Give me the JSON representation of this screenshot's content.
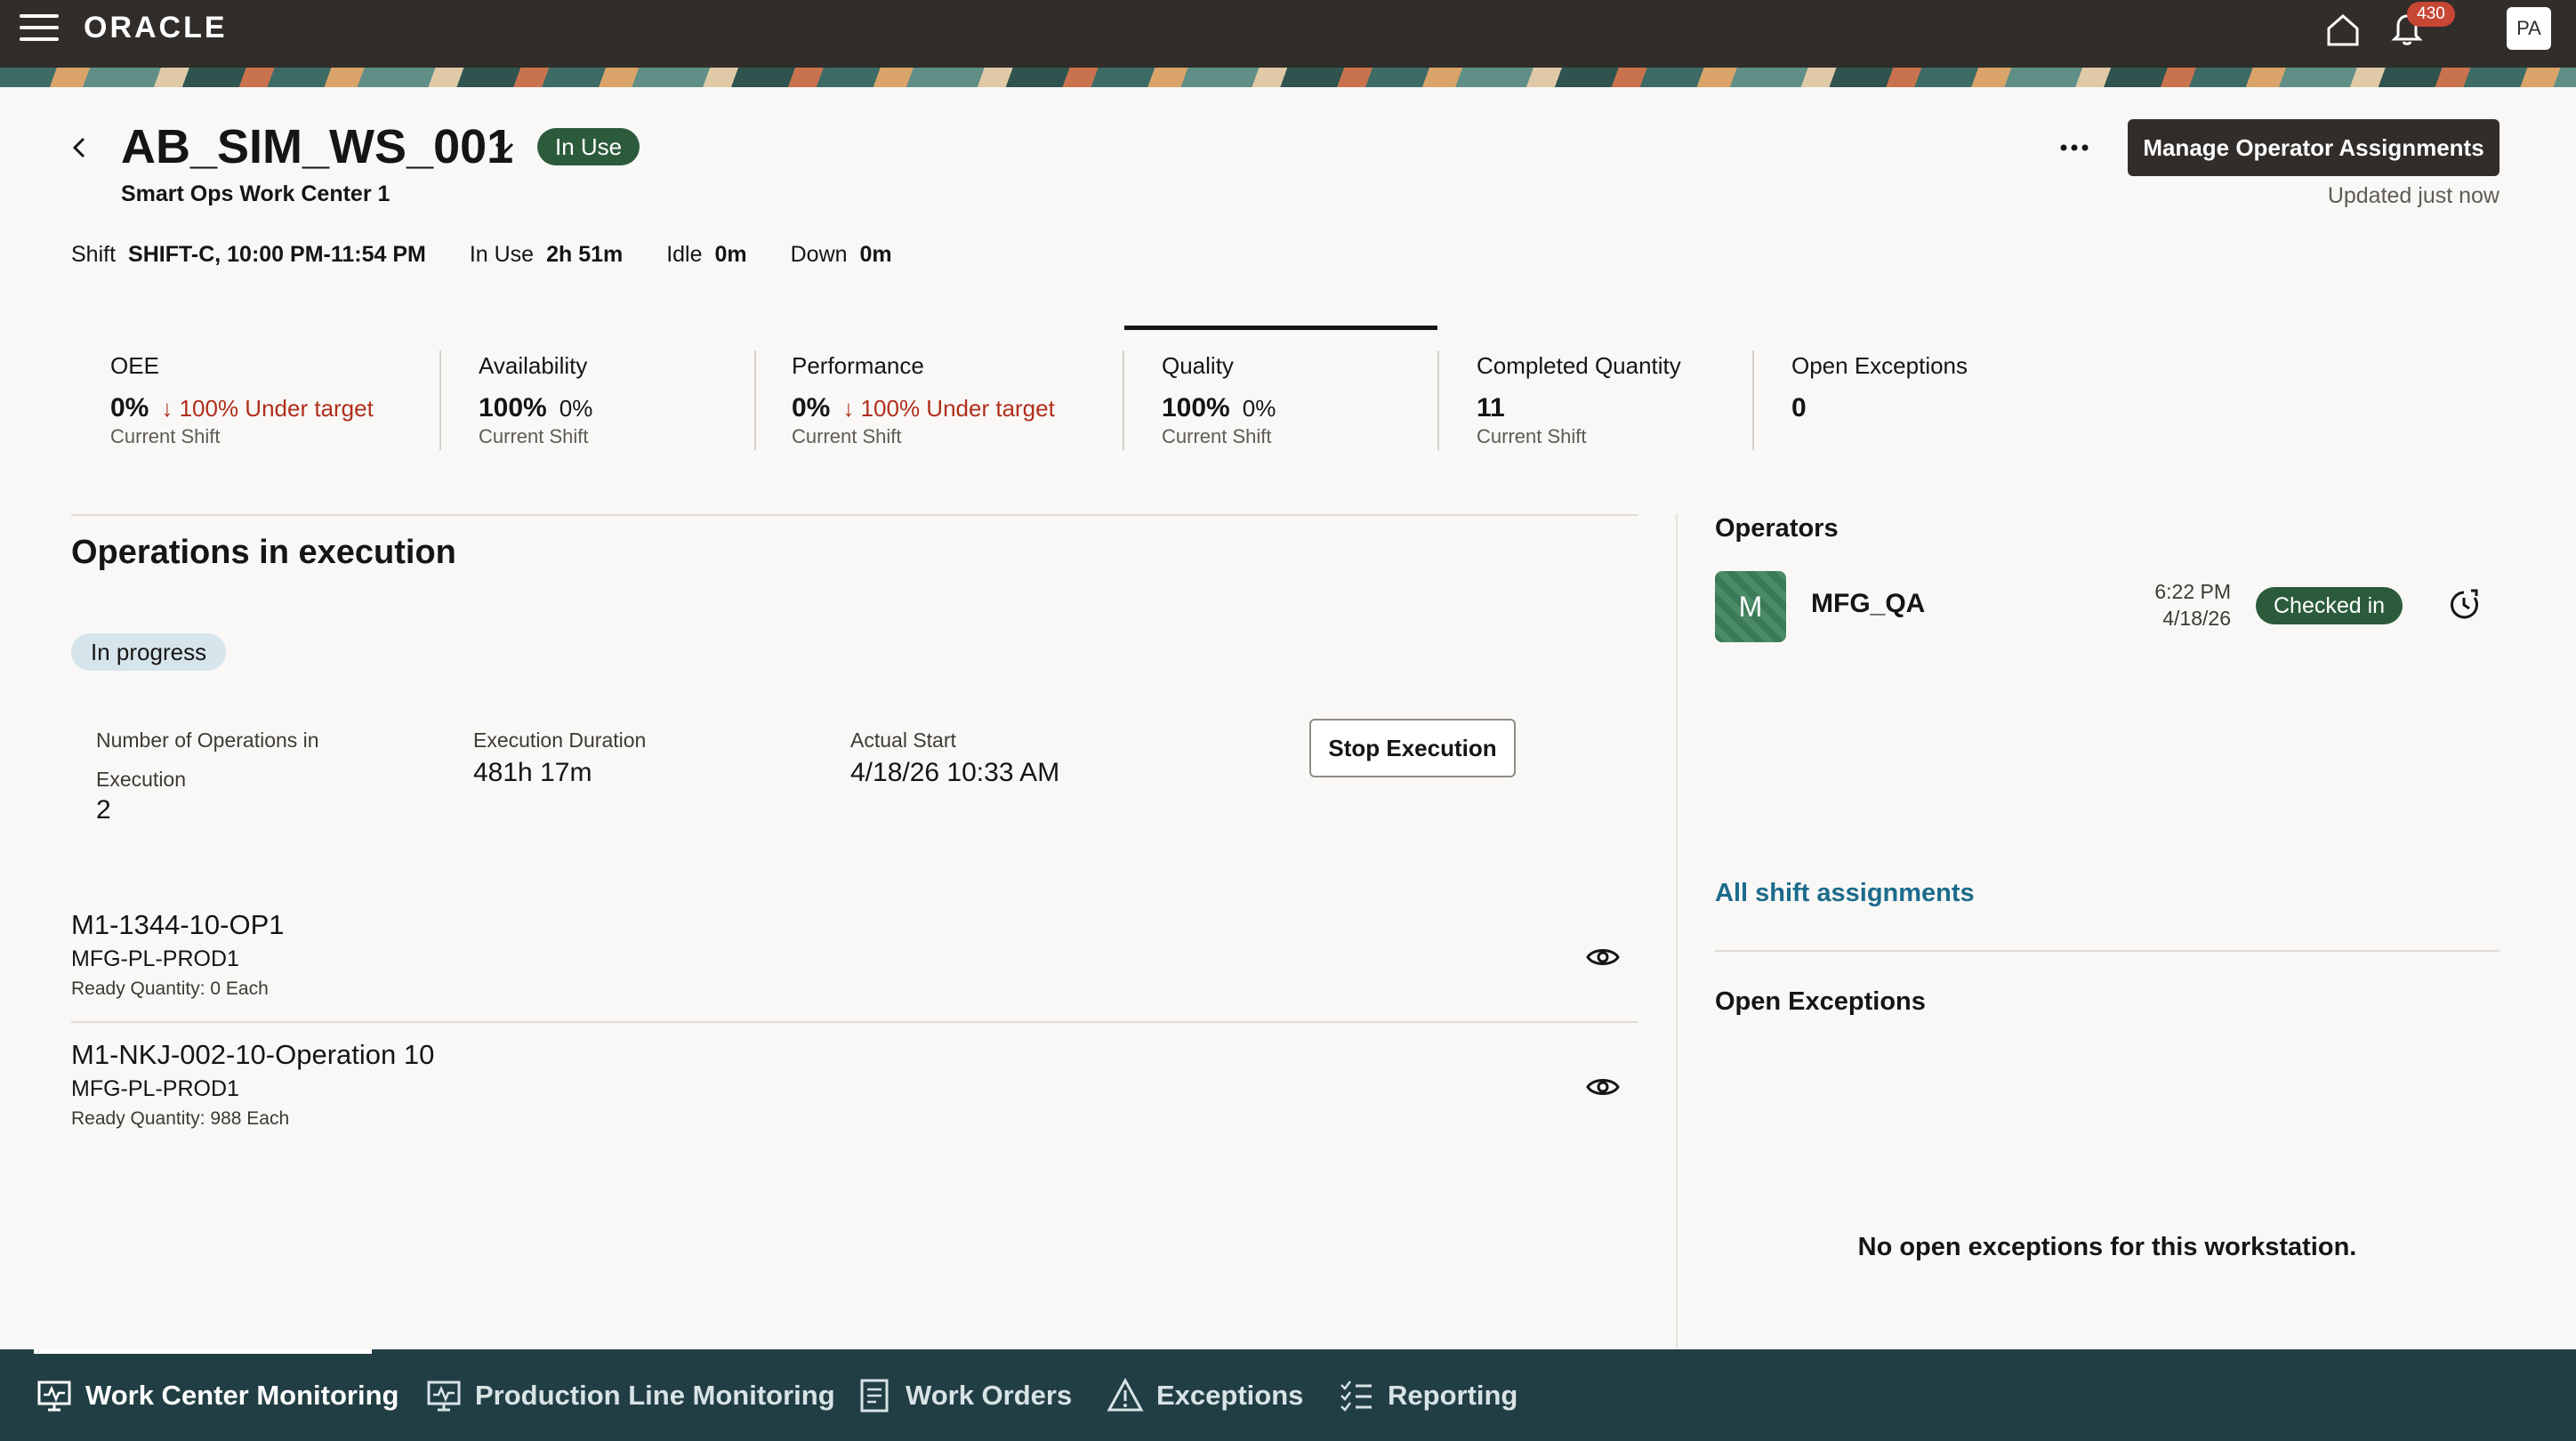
{
  "header": {
    "brand": "ORACLE",
    "notification_count": "430",
    "user_initials": "PA"
  },
  "page": {
    "title": "AB_SIM_WS_001",
    "status": "In Use",
    "subtitle": "Smart Ops Work Center 1",
    "manage_button": "Manage Operator Assignments",
    "updated": "Updated just now"
  },
  "shift": {
    "shift_label": "Shift",
    "shift_value": "SHIFT-C, 10:00 PM-11:54 PM",
    "inuse_label": "In Use",
    "inuse_value": "2h 51m",
    "idle_label": "Idle",
    "idle_value": "0m",
    "down_label": "Down",
    "down_value": "0m"
  },
  "metrics": [
    {
      "label": "OEE",
      "value": "0%",
      "delta": "↓ 100% Under target",
      "sub": "Current Shift"
    },
    {
      "label": "Availability",
      "value": "100%",
      "delta": "0%",
      "sub": "Current Shift"
    },
    {
      "label": "Performance",
      "value": "0%",
      "delta": "↓ 100% Under target",
      "sub": "Current Shift"
    },
    {
      "label": "Quality",
      "value": "100%",
      "delta": "0%",
      "sub": "Current Shift"
    },
    {
      "label": "Completed Quantity",
      "value": "11",
      "delta": "",
      "sub": "Current Shift"
    },
    {
      "label": "Open Exceptions",
      "value": "0",
      "delta": "",
      "sub": ""
    }
  ],
  "operations": {
    "title": "Operations in execution",
    "status_pill": "In progress",
    "num_ops_label_1": "Number of Operations in",
    "num_ops_label_2": "Execution",
    "num_ops_value": "2",
    "duration_label": "Execution Duration",
    "duration_value": "481h 17m",
    "start_label": "Actual Start",
    "start_value": "4/18/26 10:33 AM",
    "stop_button": "Stop Execution",
    "items": [
      {
        "name": "M1-1344-10-OP1",
        "line": "MFG-PL-PROD1",
        "qty": "Ready Quantity: 0 Each"
      },
      {
        "name": "M1-NKJ-002-10-Operation 10",
        "line": "MFG-PL-PROD1",
        "qty": "Ready Quantity: 988 Each"
      }
    ]
  },
  "operators": {
    "title": "Operators",
    "avatar_initial": "M",
    "name": "MFG_QA",
    "time": "6:22 PM",
    "date": "4/18/26",
    "status": "Checked in",
    "all_shift_link": "All shift assignments"
  },
  "exceptions": {
    "title": "Open Exceptions",
    "empty_message": "No open exceptions for this workstation."
  },
  "bottom_nav": [
    {
      "label": "Work Center Monitoring",
      "icon": "monitor-icon",
      "active": true
    },
    {
      "label": "Production Line Monitoring",
      "icon": "monitor-icon",
      "active": false
    },
    {
      "label": "Work Orders",
      "icon": "document-icon",
      "active": false
    },
    {
      "label": "Exceptions",
      "icon": "warning-icon",
      "active": false
    },
    {
      "label": "Reporting",
      "icon": "checklist-icon",
      "active": false
    }
  ],
  "colors": {
    "header_bg": "#312d2a",
    "nav_bg": "#213e44",
    "status_green": "#2c5b3c",
    "alert_red": "#b02e1c",
    "link_blue": "#1c6b8c"
  }
}
